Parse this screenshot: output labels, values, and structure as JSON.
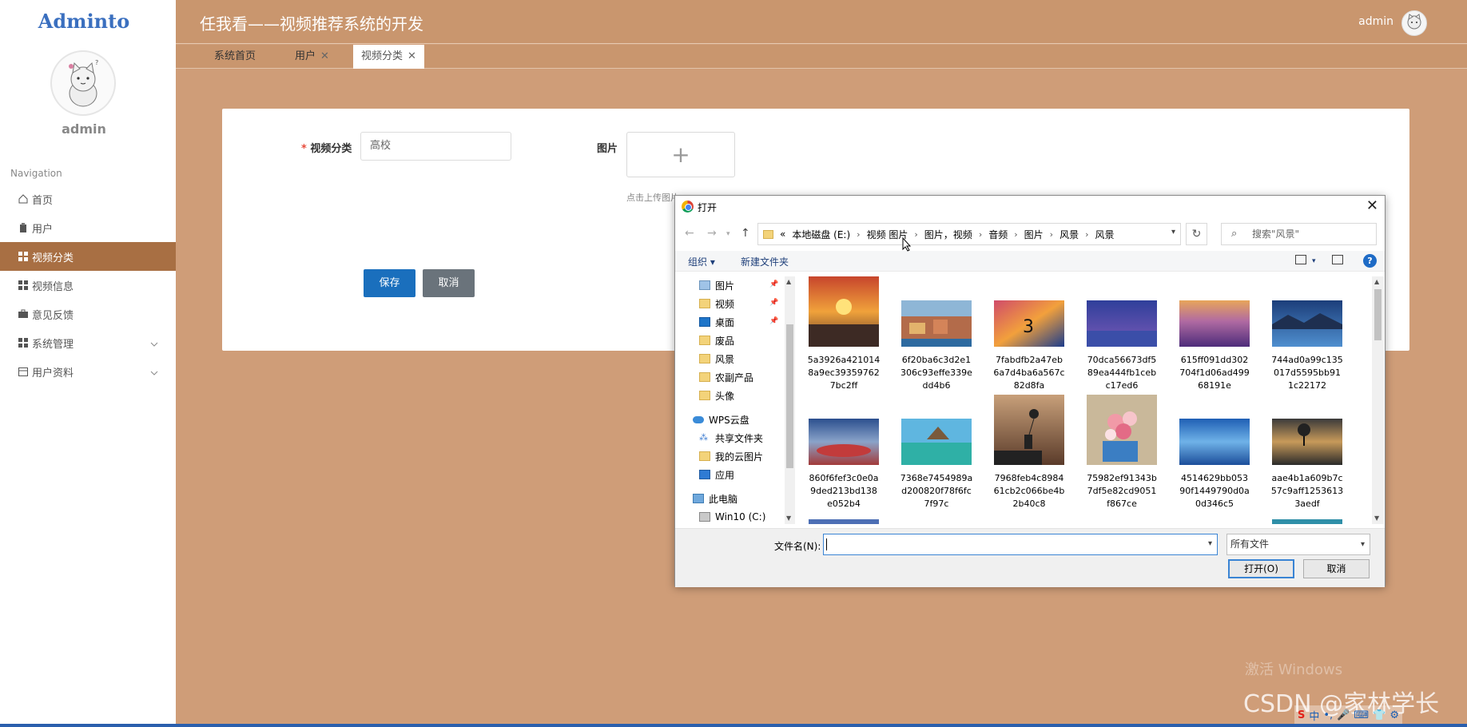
{
  "sidebar": {
    "logo": "Adminto",
    "username": "admin",
    "nav_title": "Navigation",
    "items": [
      {
        "label": "首页",
        "icon": "home-icon"
      },
      {
        "label": "用户",
        "icon": "clipboard-icon"
      },
      {
        "label": "视频分类",
        "icon": "grid-icon",
        "active": true
      },
      {
        "label": "视频信息",
        "icon": "grid-icon"
      },
      {
        "label": "意见反馈",
        "icon": "briefcase-icon"
      },
      {
        "label": "系统管理",
        "icon": "grid-icon",
        "expandable": true
      },
      {
        "label": "用户资料",
        "icon": "calendar-icon",
        "expandable": true
      }
    ]
  },
  "header": {
    "title": "任我看——视频推荐系统的开发",
    "user": "admin"
  },
  "tabs": [
    {
      "label": "系统首页"
    },
    {
      "label": "用户",
      "closable": true
    },
    {
      "label": "视频分类",
      "closable": true,
      "active": true
    }
  ],
  "form": {
    "category_label": "视频分类",
    "category_value": "高校",
    "image_label": "图片",
    "upload_plus": "+",
    "upload_hint": "点击上传图片",
    "save": "保存",
    "cancel": "取消"
  },
  "dialog": {
    "title": "打开",
    "breadcrumb": [
      "«",
      "本地磁盘 (E:)",
      "视频 图片",
      "图片，视频",
      "音频",
      "图片",
      "风景",
      "风景"
    ],
    "search_placeholder": "搜索\"风景\"",
    "organize": "组织 ▾",
    "new_folder": "新建文件夹",
    "tree": [
      {
        "label": "图片",
        "icon": "pictures-folder-icon",
        "pinned": true
      },
      {
        "label": "视频",
        "icon": "folder-icon",
        "pinned": true
      },
      {
        "label": "桌面",
        "icon": "desktop-icon",
        "pinned": true
      },
      {
        "label": "废品",
        "icon": "folder-icon"
      },
      {
        "label": "风景",
        "icon": "folder-icon"
      },
      {
        "label": "农副产品",
        "icon": "folder-icon"
      },
      {
        "label": "头像",
        "icon": "folder-icon"
      },
      {
        "label": "WPS云盘",
        "icon": "cloud-icon"
      },
      {
        "label": "共享文件夹",
        "icon": "share-icon"
      },
      {
        "label": "我的云图片",
        "icon": "folder-icon"
      },
      {
        "label": "应用",
        "icon": "apps-icon"
      },
      {
        "label": "此电脑",
        "icon": "computer-icon"
      },
      {
        "label": "Win10 (C:)",
        "icon": "drive-icon"
      }
    ],
    "files": [
      {
        "name": "5a3926a421014 8a9ec39359762 7bc2ff",
        "line1": "5a3926a421014",
        "line2": "8a9ec39359762",
        "line3": "7bc2ff"
      },
      {
        "name": "6f20ba6c3d2e1306c93effe339edd4b6",
        "line1": "6f20ba6c3d2e1",
        "line2": "306c93effe339e",
        "line3": "dd4b6"
      },
      {
        "name": "7fabdfb2a47eb6a7d4ba6a567c82d8fa",
        "line1": "7fabdfb2a47eb",
        "line2": "6a7d4ba6a567c",
        "line3": "82d8fa"
      },
      {
        "name": "70dca56673df589ea444fb1cebc17ed6",
        "line1": "70dca56673df5",
        "line2": "89ea444fb1ceb",
        "line3": "c17ed6"
      },
      {
        "name": "615ff091dd302704f1d06ad49968191e",
        "line1": "615ff091dd302",
        "line2": "704f1d06ad499",
        "line3": "68191e"
      },
      {
        "name": "744ad0a99c135017d5595bb911c22172",
        "line1": "744ad0a99c135",
        "line2": "017d5595bb91",
        "line3": "1c22172"
      },
      {
        "name": "860f6fef3c0e0a9ded213bd138e052b4",
        "line1": "860f6fef3c0e0a",
        "line2": "9ded213bd138",
        "line3": "e052b4"
      },
      {
        "name": "7368e7454989ad200820f78f6fc7f97c",
        "line1": "7368e7454989a",
        "line2": "d200820f78f6fc",
        "line3": "7f97c"
      },
      {
        "name": "7968feb4c898461cb2c066be4b2b40c8",
        "line1": "7968feb4c8984",
        "line2": "61cb2c066be4b",
        "line3": "2b40c8"
      },
      {
        "name": "75982ef91343b7df5e82cd9051f867ce",
        "line1": "75982ef91343b",
        "line2": "7df5e82cd9051",
        "line3": "f867ce"
      },
      {
        "name": "4514629bb05390f1449790d0a0d346c5",
        "line1": "4514629bb053",
        "line2": "90f1449790d0a",
        "line3": "0d346c5"
      },
      {
        "name": "aae4b1a609b7c57c9aff12536133aedf",
        "line1": "aae4b1a609b7c",
        "line2": "57c9aff1253613",
        "line3": "3aedf"
      }
    ],
    "filename_label": "文件名(N):",
    "filename_value": "",
    "filetype": "所有文件",
    "open": "打开(O)",
    "cancel": "取消"
  },
  "watermarks": {
    "windows": "激活 Windows",
    "csdn": "CSDN @家林学长"
  },
  "ime": {
    "logo": "S",
    "lang": "中"
  }
}
